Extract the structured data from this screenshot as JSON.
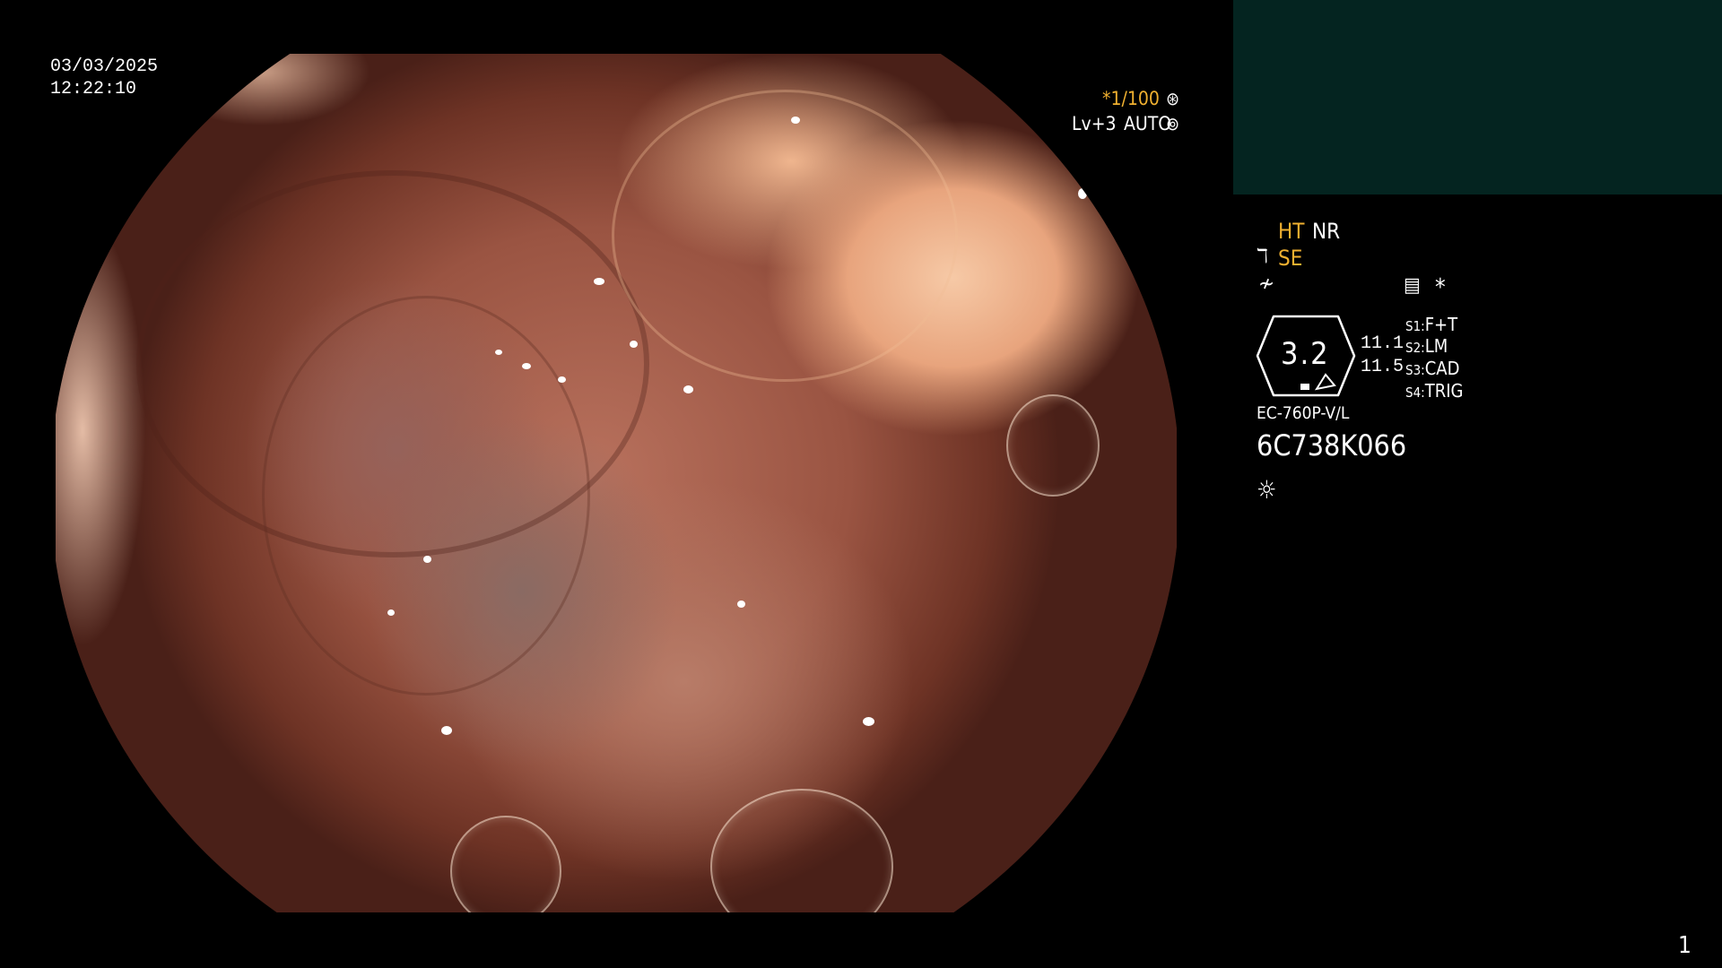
{
  "overlay": {
    "date": "03/03/2025",
    "time": "12:22:10",
    "shutter": "*1/100",
    "level": "Lv+3",
    "iris": "AUTO",
    "ht_label": "HT",
    "nr_label": "NR",
    "se_label": "SE",
    "zoom_value": "3.2",
    "value_1": "11.1",
    "value_2": "11.5",
    "switches": [
      {
        "key": "S1:",
        "value": "F+T"
      },
      {
        "key": "S2:",
        "value": "LM"
      },
      {
        "key": "S3:",
        "value": "CAD"
      },
      {
        "key": "S4:",
        "value": "TRIG"
      }
    ],
    "scope_model": "EC-760P-V/L",
    "serial": "6C738K066",
    "asterisk": "*",
    "page_number": "1"
  },
  "colors": {
    "panel_box": "#042420",
    "accent_orange": "#f0b030",
    "text": "#ffffff"
  },
  "icons": [
    "aperture-icon",
    "settings-circle-icon",
    "tool-icon",
    "freeze-icon",
    "memory-icon",
    "light-icon"
  ]
}
